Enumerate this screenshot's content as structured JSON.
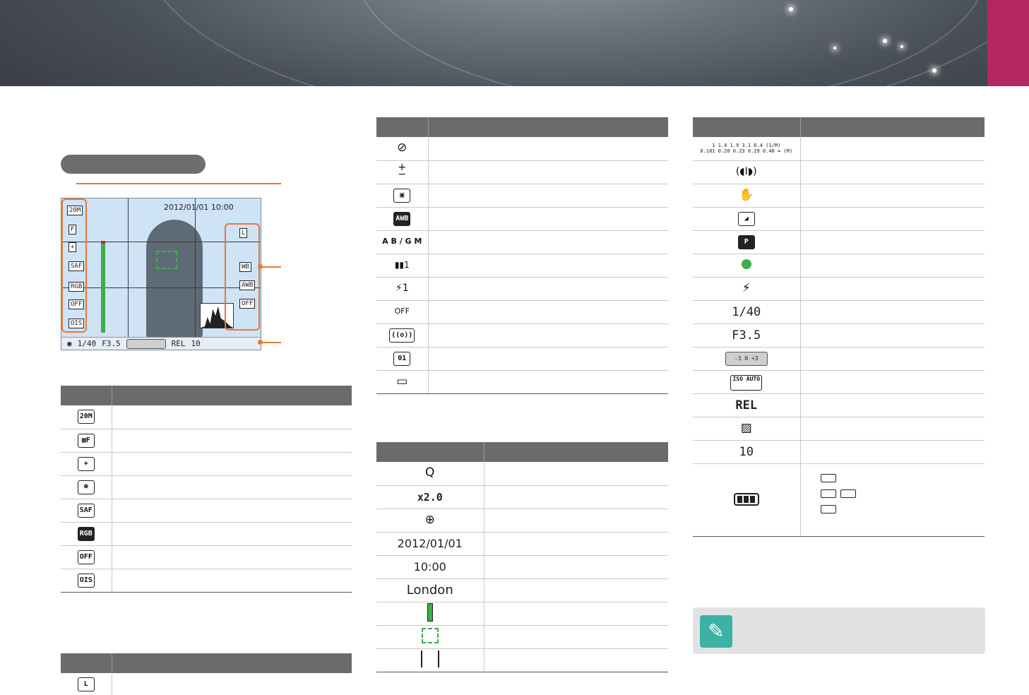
{
  "lcd": {
    "date": "2012/01/01",
    "time": "10:00",
    "bottom": [
      "1/40",
      "F3.5",
      "REL",
      "10"
    ],
    "icons_left": [
      "20M",
      "F",
      "+",
      "SAF",
      "RGB",
      "OFF",
      "OIS"
    ],
    "icons_right": [
      "L",
      "WB",
      "AWB",
      "OFF"
    ]
  },
  "table_a": {
    "rows": [
      {
        "icon": "20M",
        "icon_name": "resolution-20m-icon"
      },
      {
        "icon": "▦F",
        "icon_name": "quality-fine-icon"
      },
      {
        "icon": "+",
        "icon_name": "center-af-icon"
      },
      {
        "icon": "☻",
        "icon_name": "face-detection-af-icon"
      },
      {
        "icon": "SAF",
        "icon_name": "single-af-icon"
      },
      {
        "icon": "RGB",
        "icon_name": "color-space-srgb-icon"
      },
      {
        "icon": "OFF",
        "icon_name": "smart-range-off-icon"
      },
      {
        "icon": "OIS",
        "icon_name": "ois-icon"
      }
    ]
  },
  "table_b": {
    "rows": [
      {
        "icon": "L",
        "icon_name": "drive-mode-single-icon"
      }
    ]
  },
  "table_c": {
    "rows": [
      {
        "icon": "⊘",
        "icon_name": "flash-off-icon"
      },
      {
        "icon": "+\n−",
        "icon_name": "exposure-icon"
      },
      {
        "icon": "▣",
        "icon_name": "metering-icon"
      },
      {
        "icon": "AWB",
        "icon_name": "white-balance-auto-icon"
      },
      {
        "icon": "A B / G M",
        "icon_name": "wb-adjust-icon"
      },
      {
        "icon": "▮▮1",
        "icon_name": "picture-wizard-icon"
      },
      {
        "icon": "⚡1",
        "icon_name": "flash-exposure-icon"
      },
      {
        "icon": "OFF",
        "icon_name": "mf-assist-off-icon"
      },
      {
        "icon": "((o))",
        "icon_name": "dynamic-range-icon"
      },
      {
        "icon": "01",
        "icon_name": "face-retouch-icon"
      },
      {
        "icon": "▭",
        "icon_name": "smart-filter-icon"
      }
    ]
  },
  "table_d": {
    "rows": [
      {
        "kind": "icon",
        "icon": "Q",
        "icon_name": "magnifier-icon"
      },
      {
        "kind": "text",
        "text": "x2.0"
      },
      {
        "kind": "icon",
        "icon": "⊕",
        "icon_name": "gps-target-icon"
      },
      {
        "kind": "text",
        "text": "2012/01/01"
      },
      {
        "kind": "text",
        "text": "10:00"
      },
      {
        "kind": "text",
        "text": "London"
      },
      {
        "kind": "gbar",
        "icon_name": "exposure-level-bar-icon"
      },
      {
        "kind": "af",
        "icon_name": "af-frame-icon"
      },
      {
        "kind": "spot",
        "icon_name": "spot-metering-area-icon"
      }
    ]
  },
  "table_e": {
    "rows": [
      {
        "kind": "scale",
        "top": "1 1.4 1.9 3.1 6.4 (1/M)",
        "bottom": "0.181 0.20 0.23 0.29 0.40 ∞ (M)"
      },
      {
        "kind": "icon",
        "icon": "(◖I◗)",
        "icon_name": "focus-range-icon"
      },
      {
        "kind": "icon",
        "icon": "✋",
        "icon_name": "hand-shake-warning-icon"
      },
      {
        "kind": "icon",
        "icon": "◢",
        "icon_name": "histogram-icon"
      },
      {
        "kind": "icon",
        "icon": "P",
        "icon_name": "program-mode-icon"
      },
      {
        "kind": "greendot",
        "icon_name": "focus-indicator-icon"
      },
      {
        "kind": "icon",
        "icon": "⚡",
        "icon_name": "flash-icon"
      },
      {
        "kind": "text",
        "text": "1/40"
      },
      {
        "kind": "text",
        "text": "F3.5"
      },
      {
        "kind": "evscale",
        "text": "-3 0 +3"
      },
      {
        "kind": "icon",
        "icon": "ISO AUTO",
        "icon_name": "iso-auto-icon"
      },
      {
        "kind": "text",
        "text": "REL"
      },
      {
        "kind": "icon",
        "icon": "▨",
        "icon_name": "no-card-icon"
      },
      {
        "kind": "text",
        "text": "10"
      },
      {
        "kind": "battery",
        "icon_name": "battery-full-icon"
      }
    ]
  }
}
